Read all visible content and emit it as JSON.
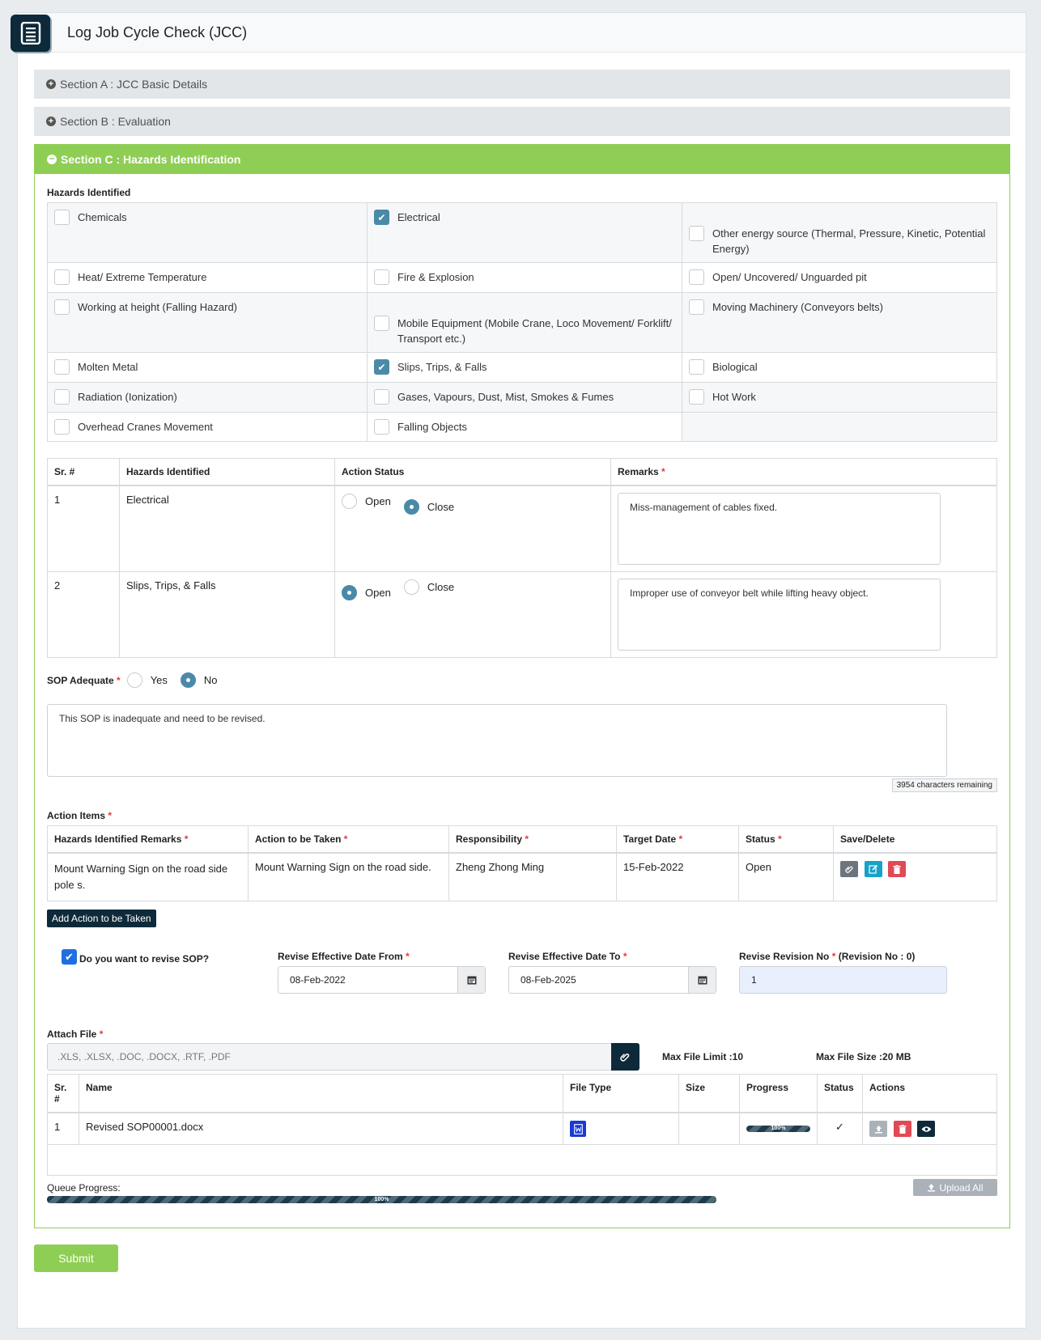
{
  "header": {
    "title": "Log Job Cycle Check (JCC)",
    "icon": "document-list-icon"
  },
  "sections": {
    "a": "Section A : JCC Basic Details",
    "b": "Section B : Evaluation",
    "c": "Section C : Hazards Identification"
  },
  "hazards": {
    "label": "Hazards Identified",
    "items": [
      {
        "label": "Chemicals",
        "checked": false
      },
      {
        "label": "Electrical",
        "checked": true
      },
      {
        "label": "Other energy source (Thermal, Pressure, Kinetic, Potential Energy)",
        "checked": false
      },
      {
        "label": "Heat/ Extreme Temperature",
        "checked": false
      },
      {
        "label": "Fire & Explosion",
        "checked": false
      },
      {
        "label": "Open/ Uncovered/ Unguarded pit",
        "checked": false
      },
      {
        "label": "Working at height (Falling Hazard)",
        "checked": false
      },
      {
        "label": "Mobile Equipment (Mobile Crane, Loco Movement/ Forklift/ Transport etc.)",
        "checked": false
      },
      {
        "label": "Moving Machinery (Conveyors belts)",
        "checked": false
      },
      {
        "label": "Molten Metal",
        "checked": false
      },
      {
        "label": "Slips, Trips, & Falls",
        "checked": true
      },
      {
        "label": "Biological",
        "checked": false
      },
      {
        "label": "Radiation (Ionization)",
        "checked": false
      },
      {
        "label": "Gases, Vapours, Dust, Mist, Smokes & Fumes",
        "checked": false
      },
      {
        "label": "Hot Work",
        "checked": false
      },
      {
        "label": "Overhead Cranes Movement",
        "checked": false
      },
      {
        "label": "Falling Objects",
        "checked": false
      }
    ]
  },
  "status_table": {
    "headers": [
      "Sr. #",
      "Hazards Identified",
      "Action Status",
      "Remarks"
    ],
    "open_label": "Open",
    "close_label": "Close",
    "rows": [
      {
        "sr": "1",
        "hazard": "Electrical",
        "status": "Close",
        "remarks": "Miss-management of cables fixed."
      },
      {
        "sr": "2",
        "hazard": "Slips, Trips, & Falls",
        "status": "Open",
        "remarks": "Improper use of conveyor belt while lifting heavy object."
      }
    ]
  },
  "sop": {
    "label": "SOP Adequate",
    "yes": "Yes",
    "no": "No",
    "selected": "No",
    "text": "This SOP is inadequate and need to be revised.",
    "remaining": "3954 characters remaining"
  },
  "action_items": {
    "label": "Action Items",
    "headers": [
      "Hazards Identified Remarks",
      "Action to be Taken",
      "Responsibility",
      "Target Date",
      "Status",
      "Save/Delete"
    ],
    "rows": [
      {
        "remarks": "Mount Warning Sign on the road side pole s.",
        "action": "Mount Warning Sign on the road side.",
        "responsibility": "Zheng Zhong Ming",
        "target": "15-Feb-2022",
        "status": "Open"
      }
    ],
    "add_button": "Add Action to be Taken"
  },
  "revise": {
    "question": "Do you want to revise SOP?",
    "checked": true,
    "from_label": "Revise Effective Date From",
    "from_value": "08-Feb-2022",
    "to_label": "Revise Effective Date To",
    "to_value": "08-Feb-2025",
    "rev_label": "Revise Revision No",
    "rev_note": "(Revision No : 0)",
    "rev_value": "1"
  },
  "attach": {
    "label": "Attach File",
    "placeholder": ".XLS, .XLSX, .DOC, .DOCX, .RTF, .PDF",
    "max_limit": "Max File Limit :10",
    "max_size": "Max File Size :20 MB",
    "headers": [
      "Sr. #",
      "Name",
      "File Type",
      "Size",
      "Progress",
      "Status",
      "Actions"
    ],
    "files": [
      {
        "sr": "1",
        "name": "Revised SOP00001.docx",
        "size": "",
        "progress": "100%",
        "progress_value": 1.0
      }
    ],
    "queue_label": "Queue Progress:",
    "queue_progress": "100%",
    "queue_value": 1.0,
    "upload_all": "Upload All"
  },
  "submit": "Submit",
  "colors": {
    "accent": "#8fce54",
    "dark": "#0e2a3a",
    "checkbox": "#4a8aa8"
  }
}
